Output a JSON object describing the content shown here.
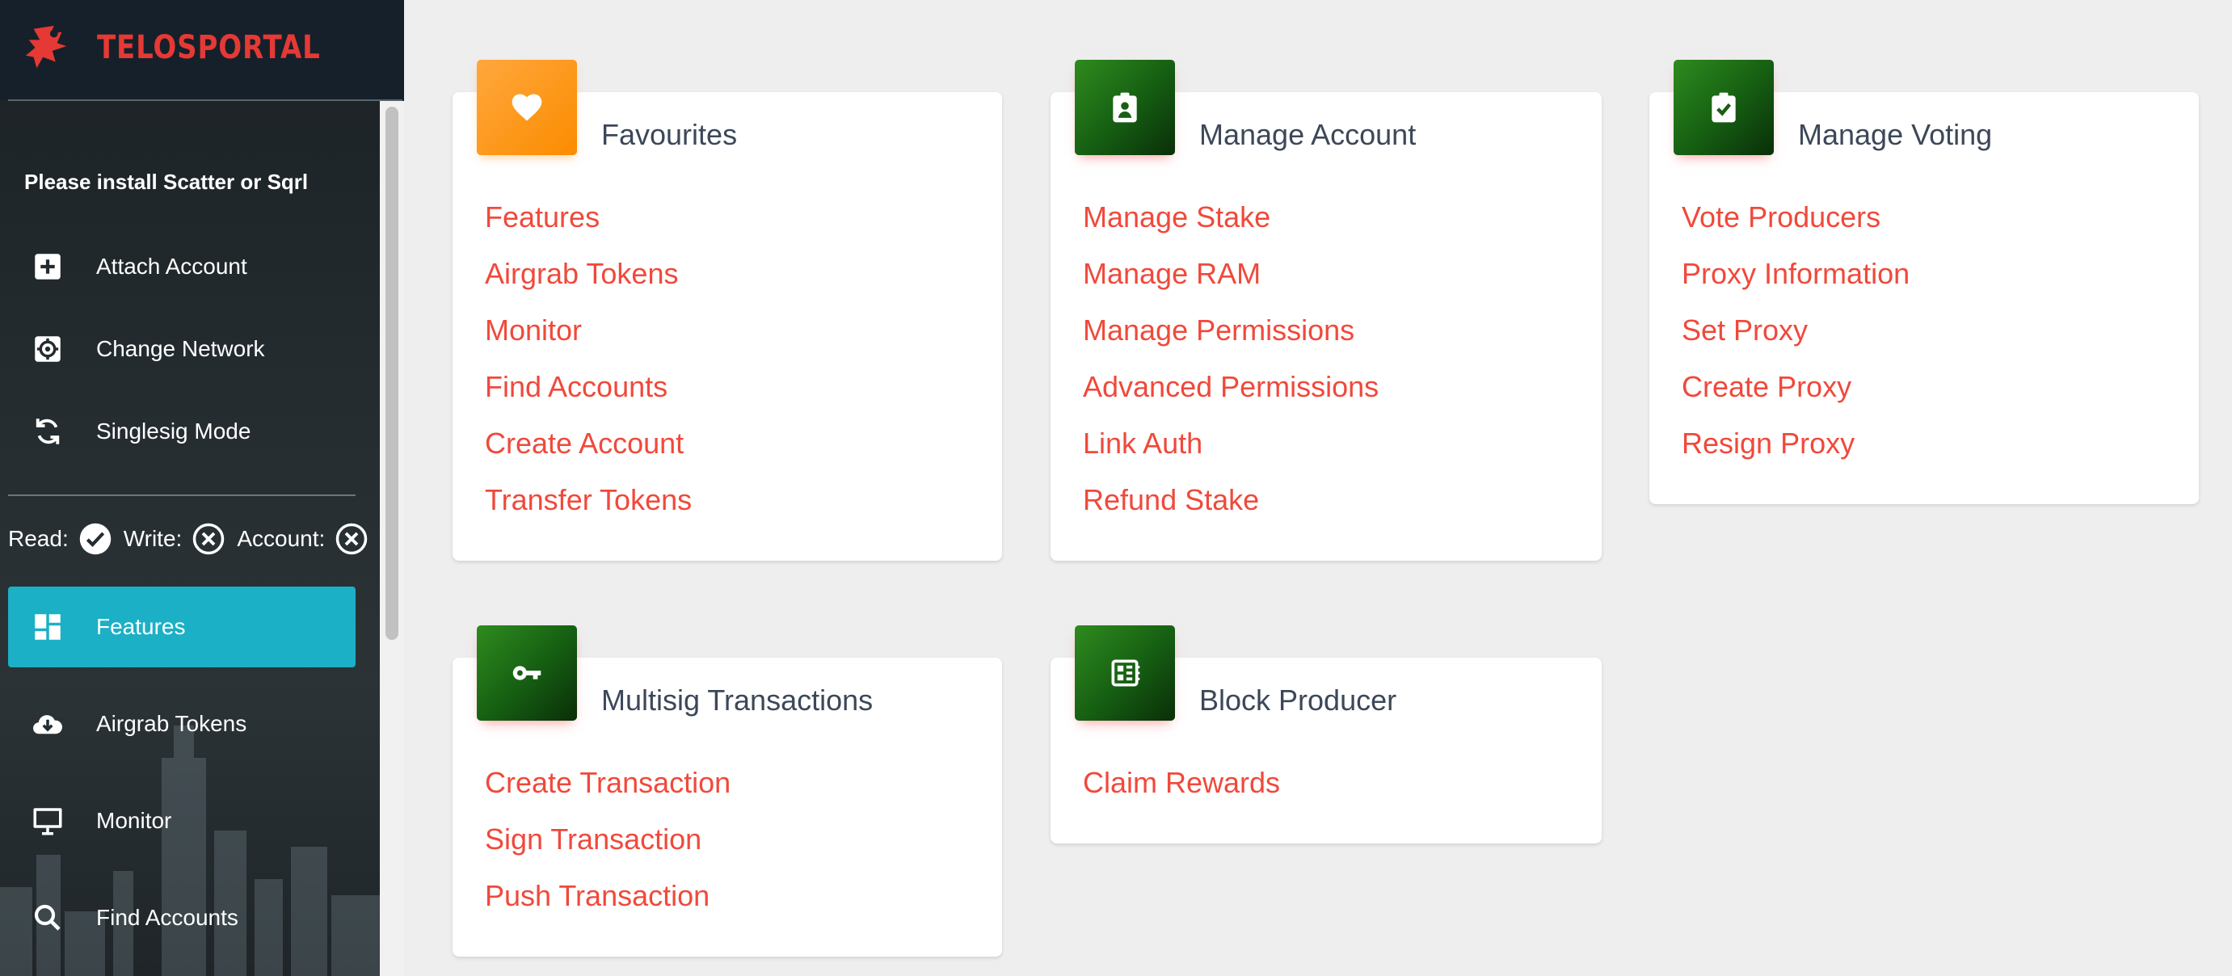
{
  "brand": {
    "name": "TELOSPORTAL"
  },
  "sidebar": {
    "install_message": "Please install Scatter or Sqrl",
    "actions": [
      {
        "label": "Attach Account",
        "icon": "plus-box-icon"
      },
      {
        "label": "Change Network",
        "icon": "gear-icon"
      },
      {
        "label": "Singlesig Mode",
        "icon": "sync-icon"
      }
    ],
    "status": {
      "read_label": "Read:",
      "write_label": "Write:",
      "account_label": "Account:",
      "read_state": "check",
      "write_state": "cross",
      "account_state": "cross"
    },
    "nav": [
      {
        "label": "Features",
        "icon": "dashboard-icon",
        "active": true
      },
      {
        "label": "Airgrab Tokens",
        "icon": "cloud-download-icon",
        "active": false
      },
      {
        "label": "Monitor",
        "icon": "monitor-icon",
        "active": false
      },
      {
        "label": "Find Accounts",
        "icon": "search-icon",
        "active": false
      }
    ]
  },
  "cards": [
    {
      "title": "Favourites",
      "icon": "heart-icon",
      "links": [
        "Features",
        "Airgrab Tokens",
        "Monitor",
        "Find Accounts",
        "Create Account",
        "Transfer Tokens"
      ]
    },
    {
      "title": "Manage Account",
      "icon": "account-badge-icon",
      "links": [
        "Manage Stake",
        "Manage RAM",
        "Manage Permissions",
        "Advanced Permissions",
        "Link Auth",
        "Refund Stake"
      ]
    },
    {
      "title": "Manage Voting",
      "icon": "clipboard-check-icon",
      "links": [
        "Vote Producers",
        "Proxy Information",
        "Set Proxy",
        "Create Proxy",
        "Resign Proxy"
      ]
    },
    {
      "title": "Multisig Transactions",
      "icon": "key-icon",
      "links": [
        "Create Transaction",
        "Sign Transaction",
        "Push Transaction"
      ]
    },
    {
      "title": "Block Producer",
      "icon": "chip-icon",
      "links": [
        "Claim Rewards"
      ]
    }
  ],
  "colors": {
    "accent": "#1bb0c6",
    "link": "#f0493b",
    "brand": "#e53935",
    "badge_orange": "#ffa73d",
    "badge_green": "#2e8b1e"
  }
}
